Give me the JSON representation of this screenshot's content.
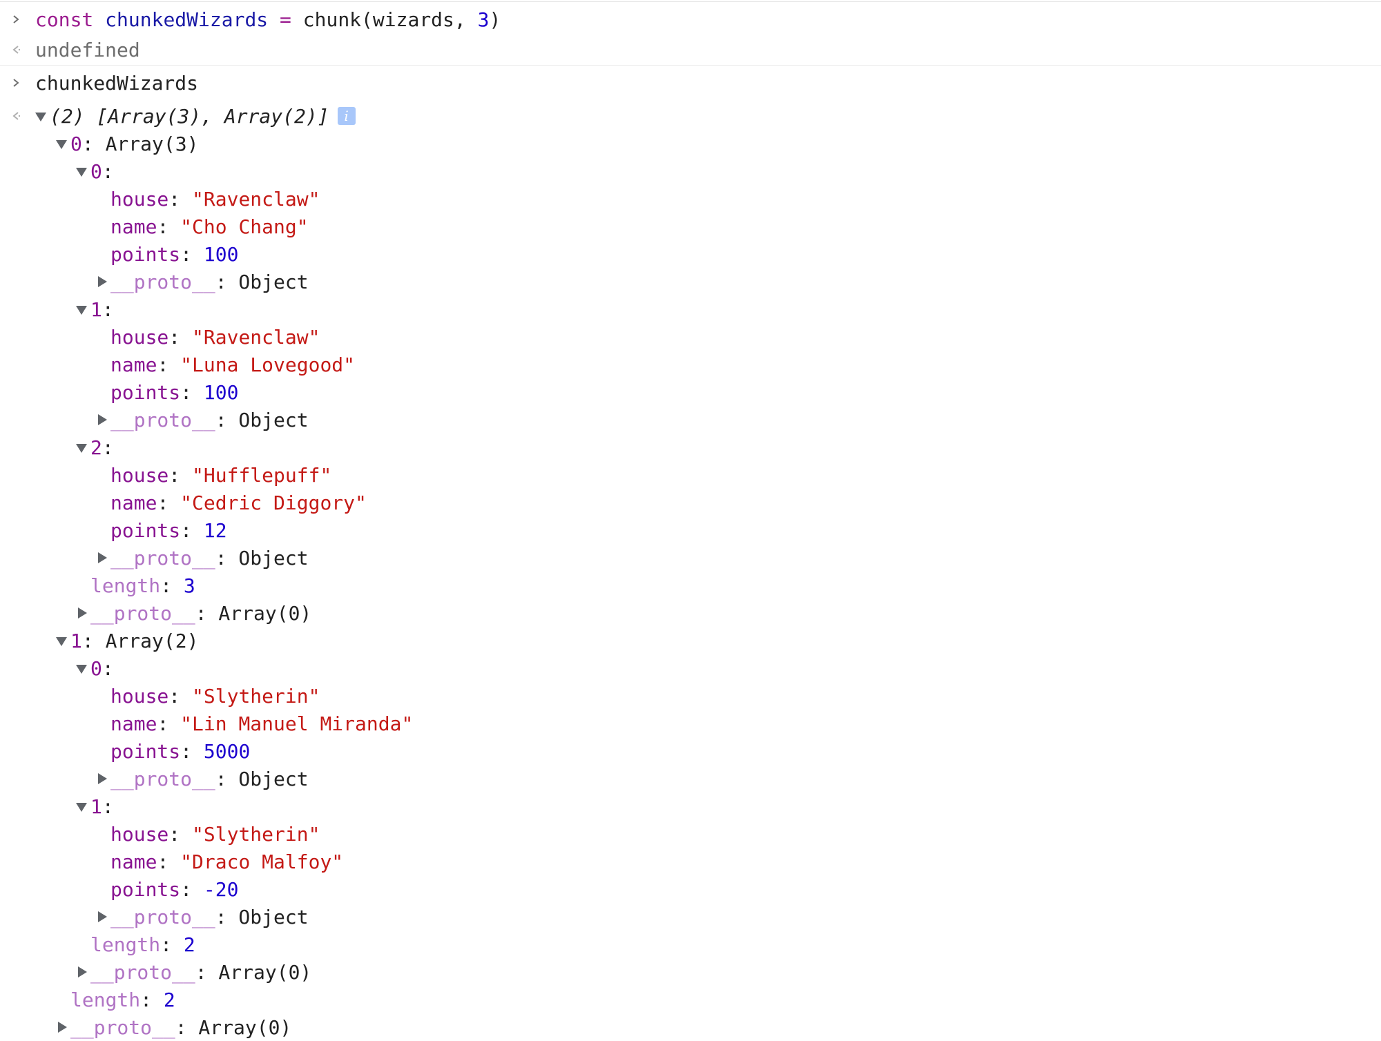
{
  "console": {
    "command1": {
      "kw": "const",
      "var": "chunkedWizards",
      "op": "=",
      "fn": "chunk(wizards,",
      "arg": "3",
      "close": ")"
    },
    "result1": "undefined",
    "command2": "chunkedWizards",
    "summary": {
      "text": "(2) [Array(3), Array(2)]",
      "info_icon": "i"
    },
    "groups": [
      {
        "label": "0",
        "type": "Array(3)",
        "items": [
          {
            "index": "0",
            "house": "\"Ravenclaw\"",
            "name": "\"Cho Chang\"",
            "points": "100"
          },
          {
            "index": "1",
            "house": "\"Ravenclaw\"",
            "name": "\"Luna Lovegood\"",
            "points": "100"
          },
          {
            "index": "2",
            "house": "\"Hufflepuff\"",
            "name": "\"Cedric Diggory\"",
            "points": "12"
          }
        ],
        "length": "3"
      },
      {
        "label": "1",
        "type": "Array(2)",
        "items": [
          {
            "index": "0",
            "house": "\"Slytherin\"",
            "name": "\"Lin Manuel Miranda\"",
            "points": "5000"
          },
          {
            "index": "1",
            "house": "\"Slytherin\"",
            "name": "\"Draco Malfoy\"",
            "points": "-20"
          }
        ],
        "length": "2"
      }
    ],
    "keys": {
      "house": "house",
      "name": "name",
      "points": "points",
      "proto": "__proto__",
      "length": "length"
    },
    "proto_object": "Object",
    "proto_array": "Array(0)",
    "outer_length": "2"
  }
}
